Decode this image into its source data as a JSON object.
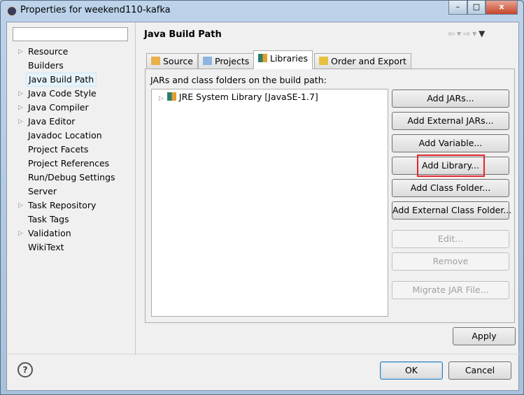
{
  "window": {
    "title": "Properties for weekend110-kafka",
    "controls": [
      "minimize",
      "maximize",
      "close"
    ]
  },
  "sidebar": {
    "filter_value": "",
    "items": [
      {
        "label": "Resource",
        "expandable": true
      },
      {
        "label": "Builders",
        "expandable": false
      },
      {
        "label": "Java Build Path",
        "expandable": false,
        "selected": true
      },
      {
        "label": "Java Code Style",
        "expandable": true
      },
      {
        "label": "Java Compiler",
        "expandable": true
      },
      {
        "label": "Java Editor",
        "expandable": true
      },
      {
        "label": "Javadoc Location",
        "expandable": false
      },
      {
        "label": "Project Facets",
        "expandable": false
      },
      {
        "label": "Project References",
        "expandable": false
      },
      {
        "label": "Run/Debug Settings",
        "expandable": false
      },
      {
        "label": "Server",
        "expandable": false
      },
      {
        "label": "Task Repository",
        "expandable": true
      },
      {
        "label": "Task Tags",
        "expandable": false
      },
      {
        "label": "Validation",
        "expandable": true
      },
      {
        "label": "WikiText",
        "expandable": false
      }
    ]
  },
  "main": {
    "title": "Java Build Path",
    "tabs": [
      {
        "label": "Source"
      },
      {
        "label": "Projects"
      },
      {
        "label": "Libraries",
        "active": true
      },
      {
        "label": "Order and Export"
      }
    ],
    "list_label": "JARs and class folders on the build path:",
    "entries": [
      {
        "label": "JRE System Library [JavaSE-1.7]"
      }
    ],
    "buttons": [
      {
        "label": "Add JARs...",
        "enabled": true
      },
      {
        "label": "Add External JARs...",
        "enabled": true
      },
      {
        "label": "Add Variable...",
        "enabled": true
      },
      {
        "label": "Add Library...",
        "enabled": true,
        "highlighted": true
      },
      {
        "label": "Add Class Folder...",
        "enabled": true
      },
      {
        "label": "Add External Class Folder...",
        "enabled": true
      },
      {
        "label": "Edit...",
        "enabled": false
      },
      {
        "label": "Remove",
        "enabled": false
      },
      {
        "label": "Migrate JAR File...",
        "enabled": false
      }
    ],
    "apply": "Apply"
  },
  "footer": {
    "help": "?",
    "ok": "OK",
    "cancel": "Cancel"
  },
  "colors": {
    "highlight": "#e0262f"
  }
}
